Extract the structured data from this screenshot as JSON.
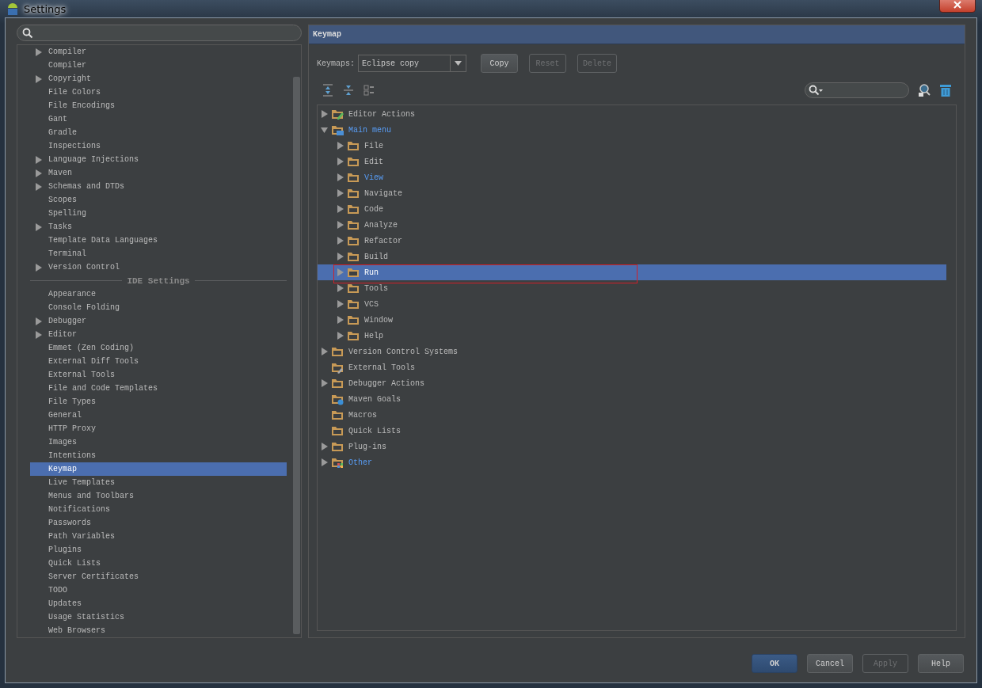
{
  "window": {
    "title": "Settings"
  },
  "sidebar": {
    "items": [
      {
        "label": "Compiler",
        "expandable": true,
        "selected": false
      },
      {
        "label": "Compiler",
        "expandable": false,
        "selected": false
      },
      {
        "label": "Copyright",
        "expandable": true,
        "selected": false
      },
      {
        "label": "File Colors",
        "expandable": false,
        "selected": false
      },
      {
        "label": "File Encodings",
        "expandable": false,
        "selected": false
      },
      {
        "label": "Gant",
        "expandable": false,
        "selected": false
      },
      {
        "label": "Gradle",
        "expandable": false,
        "selected": false
      },
      {
        "label": "Inspections",
        "expandable": false,
        "selected": false
      },
      {
        "label": "Language Injections",
        "expandable": true,
        "selected": false
      },
      {
        "label": "Maven",
        "expandable": true,
        "selected": false
      },
      {
        "label": "Schemas and DTDs",
        "expandable": true,
        "selected": false
      },
      {
        "label": "Scopes",
        "expandable": false,
        "selected": false
      },
      {
        "label": "Spelling",
        "expandable": false,
        "selected": false
      },
      {
        "label": "Tasks",
        "expandable": true,
        "selected": false
      },
      {
        "label": "Template Data Languages",
        "expandable": false,
        "selected": false
      },
      {
        "label": "Terminal",
        "expandable": false,
        "selected": false
      },
      {
        "label": "Version Control",
        "expandable": true,
        "selected": false
      },
      {
        "kind": "section",
        "label": "IDE Settings"
      },
      {
        "label": "Appearance",
        "expandable": false,
        "selected": false
      },
      {
        "label": "Console Folding",
        "expandable": false,
        "selected": false
      },
      {
        "label": "Debugger",
        "expandable": true,
        "selected": false
      },
      {
        "label": "Editor",
        "expandable": true,
        "selected": false
      },
      {
        "label": "Emmet (Zen Coding)",
        "expandable": false,
        "selected": false
      },
      {
        "label": "External Diff Tools",
        "expandable": false,
        "selected": false
      },
      {
        "label": "External Tools",
        "expandable": false,
        "selected": false
      },
      {
        "label": "File and Code Templates",
        "expandable": false,
        "selected": false
      },
      {
        "label": "File Types",
        "expandable": false,
        "selected": false
      },
      {
        "label": "General",
        "expandable": false,
        "selected": false
      },
      {
        "label": "HTTP Proxy",
        "expandable": false,
        "selected": false
      },
      {
        "label": "Images",
        "expandable": false,
        "selected": false
      },
      {
        "label": "Intentions",
        "expandable": false,
        "selected": false
      },
      {
        "label": "Keymap",
        "expandable": false,
        "selected": true
      },
      {
        "label": "Live Templates",
        "expandable": false,
        "selected": false
      },
      {
        "label": "Menus and Toolbars",
        "expandable": false,
        "selected": false
      },
      {
        "label": "Notifications",
        "expandable": false,
        "selected": false
      },
      {
        "label": "Passwords",
        "expandable": false,
        "selected": false
      },
      {
        "label": "Path Variables",
        "expandable": false,
        "selected": false
      },
      {
        "label": "Plugins",
        "expandable": false,
        "selected": false
      },
      {
        "label": "Quick Lists",
        "expandable": false,
        "selected": false
      },
      {
        "label": "Server Certificates",
        "expandable": false,
        "selected": false
      },
      {
        "label": "TODO",
        "expandable": false,
        "selected": false
      },
      {
        "label": "Updates",
        "expandable": false,
        "selected": false
      },
      {
        "label": "Usage Statistics",
        "expandable": false,
        "selected": false
      },
      {
        "label": "Web Browsers",
        "expandable": false,
        "selected": false
      }
    ]
  },
  "panel": {
    "title": "Keymap",
    "keymaps": {
      "label": "Keymaps:",
      "value": "Eclipse copy"
    },
    "buttons": [
      {
        "label": "Copy",
        "disabled": false
      },
      {
        "label": "Reset",
        "disabled": true
      },
      {
        "label": "Delete",
        "disabled": true
      }
    ],
    "tree": [
      {
        "label": "Editor Actions",
        "kind": "editor",
        "expandable": true,
        "expanded": false,
        "modified": false,
        "selected": false
      },
      {
        "label": "Main menu",
        "kind": "menu",
        "expandable": true,
        "expanded": true,
        "modified": true,
        "selected": false,
        "children": [
          {
            "label": "File",
            "kind": "folder",
            "expandable": true,
            "expanded": false,
            "modified": false,
            "selected": false
          },
          {
            "label": "Edit",
            "kind": "folder",
            "expandable": true,
            "expanded": false,
            "modified": false,
            "selected": false
          },
          {
            "label": "View",
            "kind": "folder",
            "expandable": true,
            "expanded": false,
            "modified": true,
            "selected": false
          },
          {
            "label": "Navigate",
            "kind": "folder",
            "expandable": true,
            "expanded": false,
            "modified": false,
            "selected": false
          },
          {
            "label": "Code",
            "kind": "folder",
            "expandable": true,
            "expanded": false,
            "modified": false,
            "selected": false
          },
          {
            "label": "Analyze",
            "kind": "folder",
            "expandable": true,
            "expanded": false,
            "modified": false,
            "selected": false
          },
          {
            "label": "Refactor",
            "kind": "folder",
            "expandable": true,
            "expanded": false,
            "modified": false,
            "selected": false
          },
          {
            "label": "Build",
            "kind": "folder",
            "expandable": true,
            "expanded": false,
            "modified": false,
            "selected": false
          },
          {
            "label": "Run",
            "kind": "folder",
            "expandable": true,
            "expanded": false,
            "modified": false,
            "selected": true,
            "outlined": true
          },
          {
            "label": "Tools",
            "kind": "folder",
            "expandable": true,
            "expanded": false,
            "modified": false,
            "selected": false
          },
          {
            "label": "VCS",
            "kind": "folder",
            "expandable": true,
            "expanded": false,
            "modified": false,
            "selected": false
          },
          {
            "label": "Window",
            "kind": "folder",
            "expandable": true,
            "expanded": false,
            "modified": false,
            "selected": false
          },
          {
            "label": "Help",
            "kind": "folder",
            "expandable": true,
            "expanded": false,
            "modified": false,
            "selected": false
          }
        ]
      },
      {
        "label": "Version Control Systems",
        "kind": "folder",
        "expandable": true,
        "expanded": false,
        "modified": false,
        "selected": false
      },
      {
        "label": "External Tools",
        "kind": "tools",
        "expandable": false,
        "modified": false,
        "selected": false
      },
      {
        "label": "Debugger Actions",
        "kind": "folder",
        "expandable": true,
        "expanded": false,
        "modified": false,
        "selected": false
      },
      {
        "label": "Maven Goals",
        "kind": "maven",
        "expandable": false,
        "modified": false,
        "selected": false
      },
      {
        "label": "Macros",
        "kind": "folder",
        "expandable": false,
        "modified": false,
        "selected": false
      },
      {
        "label": "Quick Lists",
        "kind": "folder",
        "expandable": false,
        "modified": false,
        "selected": false
      },
      {
        "label": "Plug-ins",
        "kind": "folder",
        "expandable": true,
        "expanded": false,
        "modified": false,
        "selected": false
      },
      {
        "label": "Other",
        "kind": "other",
        "expandable": true,
        "expanded": false,
        "modified": true,
        "selected": false
      }
    ]
  },
  "footer": {
    "buttons": [
      {
        "label": "OK",
        "kind": "primary",
        "disabled": false
      },
      {
        "label": "Cancel",
        "kind": "normal",
        "disabled": false
      },
      {
        "label": "Apply",
        "kind": "normal",
        "disabled": true
      },
      {
        "label": "Help",
        "kind": "normal",
        "disabled": false
      }
    ]
  }
}
